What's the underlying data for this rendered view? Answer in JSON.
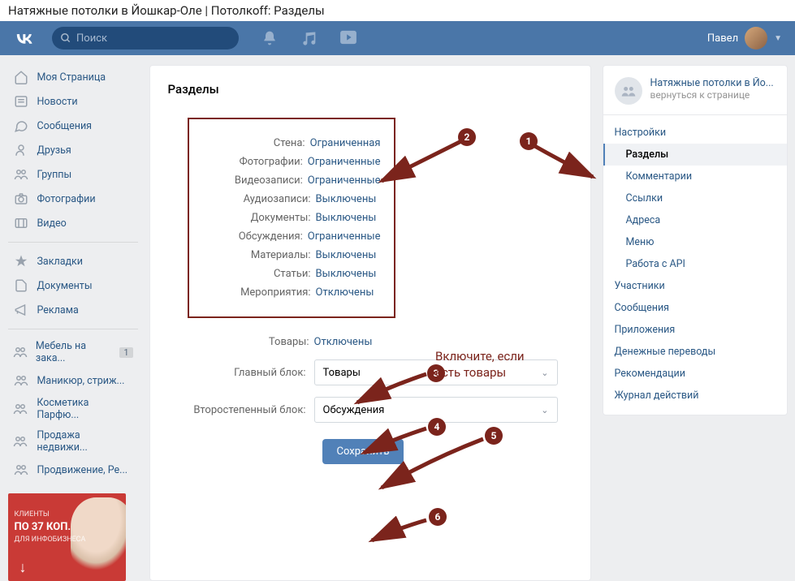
{
  "page_title": "Натяжные потолки в Йошкар-Оле | Потолкоff: Разделы",
  "search": {
    "placeholder": "Поиск"
  },
  "user": {
    "name": "Павел"
  },
  "leftnav": {
    "main": [
      "Моя Страница",
      "Новости",
      "Сообщения",
      "Друзья",
      "Группы",
      "Фотографии",
      "Видео"
    ],
    "sec": [
      "Закладки",
      "Документы",
      "Реклама"
    ],
    "groups": [
      {
        "label": "Мебель на зака...",
        "badge": "1"
      },
      {
        "label": "Маникюр, стриж..."
      },
      {
        "label": "Косметика Парфю..."
      },
      {
        "label": "Продажа недвижи..."
      },
      {
        "label": "Продвижение, Ре..."
      }
    ]
  },
  "promo": {
    "head": "КЛИЕНТЫ",
    "big": "ПО 37 КОП.",
    "sub": "ДЛЯ ИНФОБИЗНЕСА"
  },
  "main": {
    "title": "Разделы",
    "settings": [
      {
        "label": "Стена:",
        "value": "Ограниченная"
      },
      {
        "label": "Фотографии:",
        "value": "Ограниченные"
      },
      {
        "label": "Видеозаписи:",
        "value": "Ограниченные"
      },
      {
        "label": "Аудиозаписи:",
        "value": "Выключены"
      },
      {
        "label": "Документы:",
        "value": "Выключены"
      },
      {
        "label": "Обсуждения:",
        "value": "Ограниченные"
      },
      {
        "label": "Материалы:",
        "value": "Выключены"
      },
      {
        "label": "Статьи:",
        "value": "Выключены"
      },
      {
        "label": "Мероприятия:",
        "value": "Отключены"
      }
    ],
    "goods": {
      "label": "Товары:",
      "value": "Отключены"
    },
    "main_block": {
      "label": "Главный блок:",
      "value": "Товары"
    },
    "sec_block": {
      "label": "Второстепенный блок:",
      "value": "Обсуждения"
    },
    "save": "Сохранить"
  },
  "rightcol": {
    "group_name": "Натяжные потолки в Йо...",
    "back": "вернуться к странице",
    "nav": [
      {
        "label": "Настройки",
        "type": "head"
      },
      {
        "label": "Разделы",
        "type": "sub",
        "active": true
      },
      {
        "label": "Комментарии",
        "type": "sub"
      },
      {
        "label": "Ссылки",
        "type": "sub"
      },
      {
        "label": "Адреса",
        "type": "sub"
      },
      {
        "label": "Меню",
        "type": "sub"
      },
      {
        "label": "Работа с API",
        "type": "sub"
      },
      {
        "label": "Участники",
        "type": "head"
      },
      {
        "label": "Сообщения",
        "type": "head"
      },
      {
        "label": "Приложения",
        "type": "head"
      },
      {
        "label": "Денежные переводы",
        "type": "head"
      },
      {
        "label": "Рекомендации",
        "type": "head"
      },
      {
        "label": "Журнал действий",
        "type": "head"
      }
    ]
  },
  "annotations": {
    "hint": "Включите, если есть товары",
    "nums": [
      "1",
      "2",
      "3",
      "4",
      "5",
      "6"
    ]
  }
}
